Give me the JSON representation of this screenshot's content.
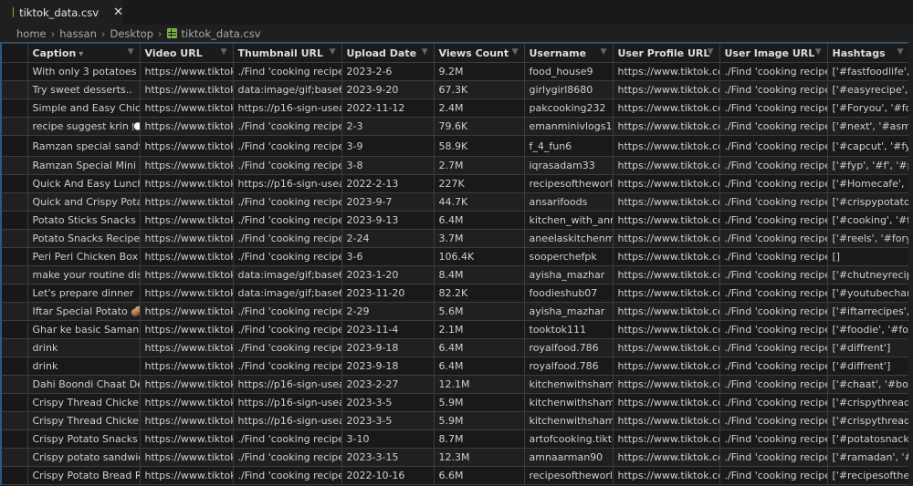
{
  "tab": {
    "title": "tiktok_data.csv",
    "close": "✕"
  },
  "breadcrumb": [
    "home",
    "hassan",
    "Desktop",
    "tiktok_data.csv"
  ],
  "columns": [
    "Caption",
    "Video URL",
    "Thumbnail URL",
    "Upload Date",
    "Views Count",
    "Username",
    "User Profile URL",
    "User Image URL",
    "Hashtags"
  ],
  "sort_indicator": "▾",
  "filter_icon": "▼",
  "rows": [
    [
      "With only 3 potatoes you",
      "https://www.tiktok",
      "./Find 'cooking recipes",
      "2023-2-6",
      "9.2M",
      "food_house9",
      "https://www.tiktok.co",
      "./Find 'cooking recipes",
      "['#fastfoodlife', '"
    ],
    [
      "Try sweet desserts..",
      "https://www.tiktok",
      "data:image/gif;base64",
      "2023-9-20",
      "67.3K",
      "girlygirl8680",
      "https://www.tiktok.co",
      "./Find 'cooking recipes",
      "['#easyrecipe', '#"
    ],
    [
      "Simple and Easy Chicken",
      "https://www.tiktok",
      "https://p16-sign-useas",
      "2022-11-12",
      "2.4M",
      "pakcooking232",
      "https://www.tiktok.co",
      "./Find 'cooking recipes",
      "['#Foryou', '#for"
    ],
    [
      "recipe suggest krin 🍽️",
      "https://www.tiktok",
      "./Find 'cooking recipes",
      "2-3",
      "79.6K",
      "emanminivlogs1",
      "https://www.tiktok.co",
      "./Find 'cooking recipes",
      "['#next', '#asmr',"
    ],
    [
      "Ramzan special sandwich",
      "https://www.tiktok",
      "./Find 'cooking recipes",
      "3-9",
      "58.9K",
      "f_4_fun6",
      "https://www.tiktok.co",
      "./Find 'cooking recipes",
      "['#capcut', '#fyp'"
    ],
    [
      "Ramzan Special Mini Ch",
      "https://www.tiktok",
      "./Find 'cooking recipes",
      "3-8",
      "2.7M",
      "iqrasadam33",
      "https://www.tiktok.co",
      "./Find 'cooking recipes",
      "['#fyp', '#f', '#pit"
    ],
    [
      "Quick And Easy Lunch/",
      "https://www.tiktok",
      "https://p16-sign-useas",
      "2022-2-13",
      "227K",
      "recipesoftheworld",
      "https://www.tiktok.co",
      "./Find 'cooking recipes",
      "['#Homecafe', '#"
    ],
    [
      "Quick and Crispy Potato",
      "https://www.tiktok",
      "./Find 'cooking recipes",
      "2023-9-7",
      "44.7K",
      "ansarifoods",
      "https://www.tiktok.co",
      "./Find 'cooking recipes",
      "['#crispypotatoe"
    ],
    [
      "Potato Sticks Snacks",
      "https://www.tiktok",
      "./Find 'cooking recipes",
      "2023-9-13",
      "6.4M",
      "kitchen_with_anm",
      "https://www.tiktok.co",
      "./Find 'cooking recipes",
      "['#cooking', '#fo"
    ],
    [
      "Potato Snacks Recipe |",
      "https://www.tiktok",
      "./Find 'cooking recipes",
      "2-24",
      "3.7M",
      "aneelaskitchenme",
      "https://www.tiktok.co",
      "./Find 'cooking recipes",
      "['#reels', '#foryo"
    ],
    [
      "Peri Peri Chicken Box P",
      "https://www.tiktok",
      "./Find 'cooking recipes",
      "3-6",
      "106.4K",
      "sooperchefpk",
      "https://www.tiktok.co",
      "./Find 'cooking recipes",
      "[]"
    ],
    [
      "make your routine dish",
      "https://www.tiktok",
      "data:image/gif;base64",
      "2023-1-20",
      "8.4M",
      "ayisha_mazhar",
      "https://www.tiktok.co",
      "./Find 'cooking recipes",
      "['#chutneyrecipe"
    ],
    [
      "Let's prepare dinner",
      "https://www.tiktok",
      "data:image/gif;base64",
      "2023-11-20",
      "82.2K",
      "foodieshub07",
      "https://www.tiktok.co",
      "./Find 'cooking recipes",
      "['#youtubechann"
    ],
    [
      "Iftar Special Potato 🥔",
      "https://www.tiktok",
      "./Find 'cooking recipes",
      "2-29",
      "5.6M",
      "ayisha_mazhar",
      "https://www.tiktok.co",
      "./Find 'cooking recipes",
      "['#iftarrecipes', '"
    ],
    [
      "Ghar ke basic Saman se",
      "https://www.tiktok",
      "./Find 'cooking recipes",
      "2023-11-4",
      "2.1M",
      "tooktok111",
      "https://www.tiktok.co",
      "./Find 'cooking recipes",
      "['#foodie', '#foo"
    ],
    [
      "drink",
      "https://www.tiktok",
      "./Find 'cooking recipes",
      "2023-9-18",
      "6.4M",
      "royalfood.786",
      "https://www.tiktok.co",
      "./Find 'cooking recipes",
      "['#diffrent']"
    ],
    [
      "drink",
      "https://www.tiktok",
      "./Find 'cooking recipes",
      "2023-9-18",
      "6.4M",
      "royalfood.786",
      "https://www.tiktok.co",
      "./Find 'cooking recipes",
      "['#diffrent']"
    ],
    [
      "Dahi Boondi Chaat Det",
      "https://www.tiktok",
      "https://p16-sign-useas",
      "2023-2-27",
      "12.1M",
      "kitchenwithshama",
      "https://www.tiktok.co",
      "./Find 'cooking recipes",
      "['#chaat', '#boor"
    ],
    [
      "Crispy Thread Chicken I",
      "https://www.tiktok",
      "https://p16-sign-useas",
      "2023-3-5",
      "5.9M",
      "kitchenwithshama",
      "https://www.tiktok.co",
      "./Find 'cooking recipes",
      "['#crispythreadc"
    ],
    [
      "Crispy Thread Chicken I",
      "https://www.tiktok",
      "https://p16-sign-useas",
      "2023-3-5",
      "5.9M",
      "kitchenwithshama",
      "https://www.tiktok.co",
      "./Find 'cooking recipes",
      "['#crispythreadc"
    ],
    [
      "Crispy Potato Snacks Re",
      "https://www.tiktok",
      "./Find 'cooking recipes",
      "3-10",
      "8.7M",
      "artofcooking.tikto",
      "https://www.tiktok.co",
      "./Find 'cooking recipes",
      "['#potatosnacks'"
    ],
    [
      "Crispy potato sandwich",
      "https://www.tiktok",
      "./Find 'cooking recipes",
      "2023-3-15",
      "12.3M",
      "amnaarman90",
      "https://www.tiktok.co",
      "./Find 'cooking recipes",
      "['#ramadan', '#ki"
    ],
    [
      "Crispy Potato Bread Ro",
      "https://www.tiktok",
      "./Find 'cooking recipes",
      "2022-10-16",
      "6.6M",
      "recipesoftheworld",
      "https://www.tiktok.co",
      "./Find 'cooking recipes",
      "['#recipesofthew"
    ]
  ]
}
